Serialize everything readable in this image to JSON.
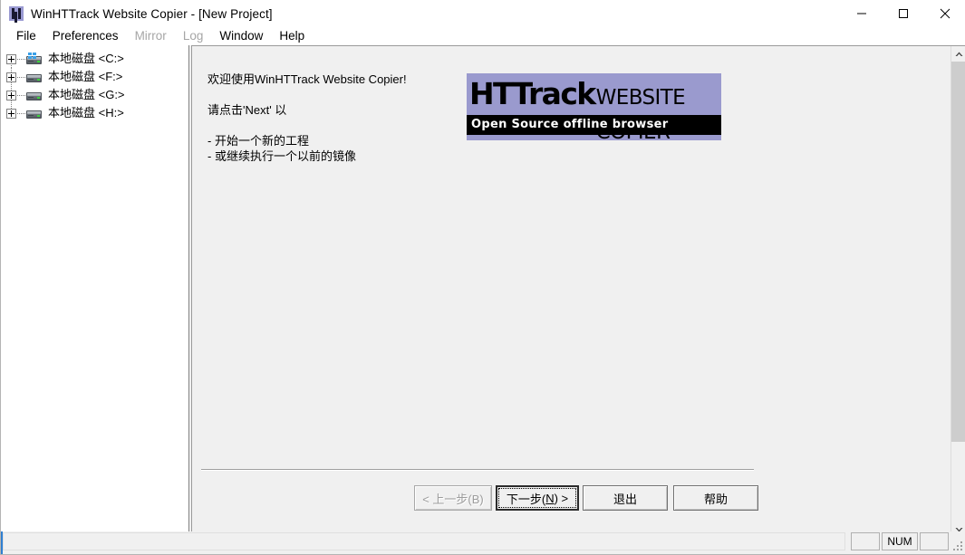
{
  "window": {
    "title": "WinHTTrack Website Copier - [New Project]",
    "icon": "httrack-logo-icon",
    "controls": [
      {
        "name": "minimize-button",
        "glyph": "minimize-icon"
      },
      {
        "name": "maximize-button",
        "glyph": "maximize-icon"
      },
      {
        "name": "close-button",
        "glyph": "close-icon"
      }
    ]
  },
  "menubar": {
    "items": [
      {
        "label": "File",
        "disabled": false
      },
      {
        "label": "Preferences",
        "disabled": false
      },
      {
        "label": "Mirror",
        "disabled": true
      },
      {
        "label": "Log",
        "disabled": true
      },
      {
        "label": "Window",
        "disabled": false
      },
      {
        "label": "Help",
        "disabled": false
      }
    ]
  },
  "sidebar": {
    "items": [
      {
        "label": "本地磁盘 <C:>",
        "icon": "drive-icon-system",
        "expander": "plus-icon",
        "system": true
      },
      {
        "label": "本地磁盘 <F:>",
        "icon": "drive-icon",
        "expander": "plus-icon",
        "system": false
      },
      {
        "label": "本地磁盘 <G:>",
        "icon": "drive-icon",
        "expander": "plus-icon",
        "system": false
      },
      {
        "label": "本地磁盘 <H:>",
        "icon": "drive-icon",
        "expander": "plus-icon",
        "system": false
      }
    ]
  },
  "main": {
    "welcome": {
      "greeting": "欢迎使用WinHTTrack Website Copier!",
      "instruction": "请点击'Next' 以",
      "bullets": [
        "- 开始一个新的工程",
        "- 或继续执行一个以前的镜像"
      ]
    },
    "logo": {
      "brand_bold": "HTTrack",
      "brand_light": "WEBSITE COPIER",
      "tagline": "Open Source offline browser",
      "background_color": "#9a9ace",
      "bar_color": "#000000",
      "text_color": "#000000",
      "tagline_color": "#ffffff"
    },
    "buttons": {
      "previous": {
        "label": "< 上一步(B)",
        "disabled": true
      },
      "next": {
        "label_pre": "下一步(",
        "label_key": "N",
        "label_post": ") >",
        "default": true,
        "focused": true
      },
      "exit": {
        "label": "退出",
        "disabled": false
      },
      "help": {
        "label": "帮助",
        "disabled": false
      }
    },
    "scrollbar": {
      "up_arrow": "chevron-up-icon",
      "down_arrow": "chevron-down-icon"
    }
  },
  "statusbar": {
    "message": "",
    "panes": [
      {
        "name": "status-pane-1",
        "text": ""
      },
      {
        "name": "status-pane-num",
        "text": "NUM"
      },
      {
        "name": "status-pane-3",
        "text": ""
      }
    ]
  }
}
